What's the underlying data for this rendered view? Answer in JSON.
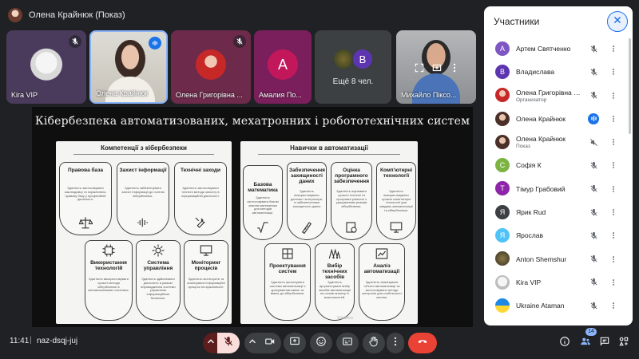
{
  "presenter": {
    "label": "Олена Крайнюк (Показ)"
  },
  "tiles": [
    {
      "name": "Kira VIP"
    },
    {
      "name": "Олена Крайнюк"
    },
    {
      "name": "Олена Григорівна ..."
    },
    {
      "name": "Амалия По...",
      "initial": "А"
    },
    {
      "more_label": "Ещё 8 чел.",
      "initial": "В"
    },
    {
      "name": "Михайло Піксо..."
    }
  ],
  "slide": {
    "title": "Кібербезпека автоматизованих, мехатронних і робототехнічних систем",
    "left_panel": {
      "heading": "Компетенції з кібербезпеки",
      "cards": [
        {
          "title": "Правова база",
          "desc": "Здатність застосовувати законодавчу та нормативно-правову базу у професійній діяльності."
        },
        {
          "title": "Захист інформації",
          "desc": "Здатність забезпечувати захист інформації до політик кібербезпеки."
        },
        {
          "title": "Технічні заходи",
          "desc": "Здатність застосовувати технічні методи захисту в інформаційній діяльності."
        },
        {
          "title": "Використання технологій",
          "desc": "Здатність використовувати сучасні методи кібербезпеки в автоматизованих системах."
        },
        {
          "title": "Система управління",
          "desc": "Здатність здійснювати діяльність в рамках впровадження системи управління інформаційною безпекою."
        },
        {
          "title": "Моніторинг процесів",
          "desc": "Здатність моніторити та аналізувати інформаційні процеси на вразливості."
        }
      ]
    },
    "right_panel": {
      "heading": "Навички в автоматизації",
      "cards": [
        {
          "title": "Базова математика",
          "desc": "Здатність застосовувати базові знання математики для методів автоматизації."
        },
        {
          "title": "Забезпечення захищеності даних",
          "desc": "Здатність використовувати датчики і контролери, із забезпеченням захищеності даних"
        },
        {
          "title": "Оцінка програмного забезпечення",
          "desc": "Здатність оцінювати сучасні технічні та програмні рішення з урахуванням ризиків кібербезпеки."
        },
        {
          "title": "Комп'ютерні технології",
          "desc": "Здатність використовувати сучасні комп'ютерні технології для завдань автоматизації та кібербезпеки."
        },
        {
          "title": "Проектування систем",
          "desc": "Здатність проектувати системи автоматизації з урахуванням вимог та вимог до кібербезпеки."
        },
        {
          "title": "Вибір технічних засобів",
          "desc": "Здатність аргументувати вибір засобів автоматизації на основі аналізу їх властивостей."
        },
        {
          "title": "Аналіз автоматизації",
          "desc": "Здатність аналізувати об'єкти автоматизації та застосовувати методи контролю для стабільності систем."
        }
      ],
      "watermark": "Windows"
    }
  },
  "bottom_bar": {
    "time": "11:41",
    "separator": "|",
    "meeting_code": "naz-dsqj-juj",
    "people_count": "14"
  },
  "participants_panel": {
    "title": "Участники",
    "participants": [
      {
        "name": "Артем Святченко",
        "initial": "А",
        "color": "#7e57c2"
      },
      {
        "name": "Владислава",
        "initial": "В",
        "color": "#5e35b1"
      },
      {
        "name": "Олена Григорівна Нака...",
        "role": "Организатор"
      },
      {
        "name": "Олена Крайнюк",
        "speaking": true
      },
      {
        "name": "Олена Крайнюк",
        "role": "Показ"
      },
      {
        "name": "Софія К",
        "initial": "С",
        "color": "#7cb342"
      },
      {
        "name": "Тімур Грабовий",
        "initial": "Т",
        "color": "#8e24aa"
      },
      {
        "name": "Ярик Rud",
        "initial": "Я",
        "color": "#3c4043"
      },
      {
        "name": "Ярослав",
        "initial": "Я",
        "color": "#4fc3f7"
      },
      {
        "name": "Anton Shemshur"
      },
      {
        "name": "Kira VIP"
      },
      {
        "name": "Ukraine Ataman"
      }
    ]
  }
}
